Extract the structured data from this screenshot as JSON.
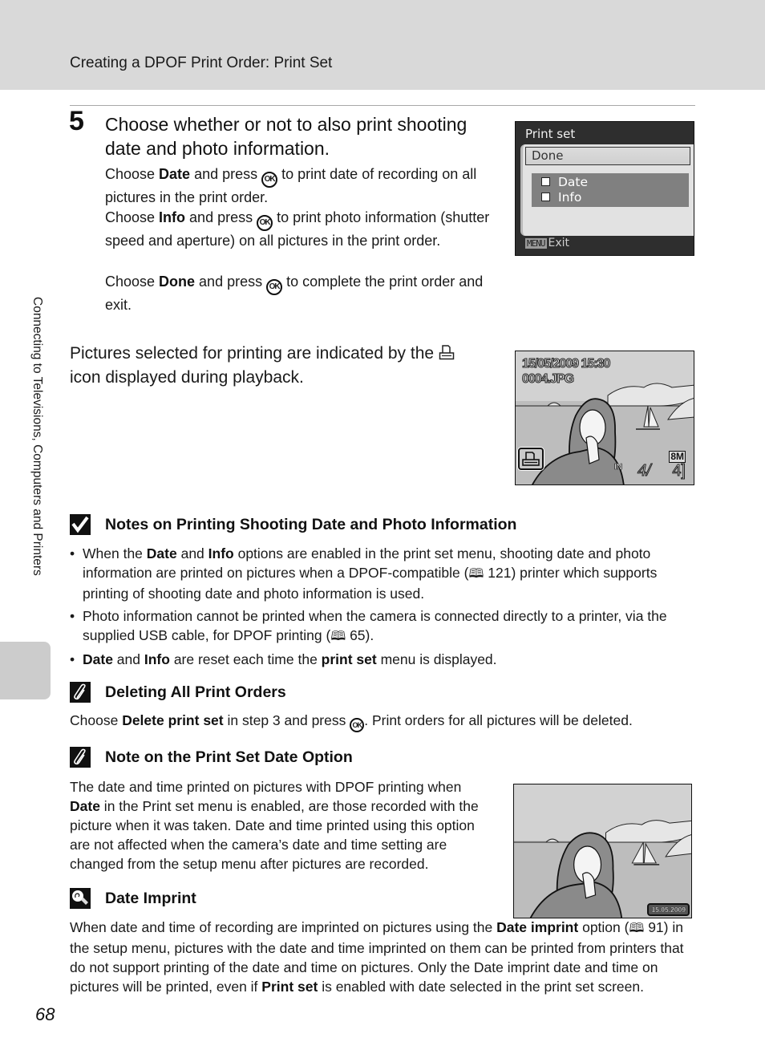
{
  "header": {
    "title": "Creating a DPOF Print Order: Print Set"
  },
  "side_tab": {
    "label": "Connecting to Televisions, Computers and Printers"
  },
  "step": {
    "number": "5",
    "title": "Choose whether or not to also print shooting date and photo information.",
    "paragraphs": [
      {
        "pre": "Choose ",
        "bold": "Date",
        "mid": " and press ",
        "button": "OK",
        "post": " to print date of recording on all pictures in the print order."
      },
      {
        "pre": "Choose ",
        "bold": "Info",
        "mid": " and press ",
        "button": "OK",
        "post": " to print photo information (shutter speed and aperture) on all pictures in the print order."
      },
      {
        "pre": "Choose ",
        "bold": "Done",
        "mid": " and press ",
        "button": "OK",
        "post": " to complete the print order and exit."
      }
    ]
  },
  "camera_menu": {
    "title": "Print set",
    "done_label": "Done",
    "options": [
      {
        "label": "Date",
        "checked": false
      },
      {
        "label": "Info",
        "checked": false
      }
    ],
    "menu_badge": "MENU",
    "exit_label": "Exit"
  },
  "indicated_text": {
    "pre": "Pictures selected for printing are indicated by the",
    "icon": "print-order-icon",
    "post": "icon displayed during playback."
  },
  "playback_screen": {
    "datetime": "15/05/2009 15:30",
    "filename": "0004.JPG",
    "image_size": "8M",
    "memory": "IN",
    "frame_current": "4/",
    "frame_total": "4]"
  },
  "notes": [
    {
      "icon": "check-icon",
      "title": "Notes on Printing Shooting Date and Photo Information",
      "bullets": [
        {
          "parts": [
            {
              "t": "When the "
            },
            {
              "b": "Date"
            },
            {
              "t": " and "
            },
            {
              "b": "Info"
            },
            {
              "t": " options are enabled in the print set menu, shooting date and photo information are printed on pictures when a DPOF-compatible ("
            },
            {
              "ref": "121"
            },
            {
              "t": ") printer which supports printing of shooting date and photo information is used."
            }
          ]
        },
        {
          "parts": [
            {
              "t": "Photo information cannot be printed when the camera is connected directly to a printer, via the supplied USB cable, for DPOF printing ("
            },
            {
              "ref": "65"
            },
            {
              "t": ")."
            }
          ]
        },
        {
          "parts": [
            {
              "b": "Date"
            },
            {
              "t": " and "
            },
            {
              "b": "Info"
            },
            {
              "t": " are reset each time the "
            },
            {
              "b": "print set"
            },
            {
              "t": " menu is displayed."
            }
          ]
        }
      ]
    },
    {
      "icon": "paperclip-icon",
      "title": "Deleting All Print Orders",
      "text": {
        "pre": "Choose ",
        "bold": "Delete print set",
        "mid": " in step 3 and press ",
        "button": "OK",
        "post": ". Print orders for all pictures will be deleted."
      }
    },
    {
      "icon": "paperclip-icon",
      "title": "Note on the Print Set Date Option",
      "text": {
        "pre": "The date and time printed on pictures with DPOF printing when ",
        "bold": "Date",
        "post": " in the Print set menu is enabled, are those recorded with the picture when it was taken. Date and time printed using this option are not affected when the camera’s date and time setting are changed from the setup menu after pictures are recorded."
      }
    },
    {
      "icon": "lightbulb-icon",
      "title": "Date Imprint",
      "text": {
        "pre": "When date and time of recording are imprinted on pictures using the ",
        "bold": "Date imprint",
        "mid": " option (",
        "ref": "91",
        "mid2": ") in the setup menu, pictures with the date and time imprinted on them can be printed from printers that do not support printing of the date and time on pictures. Only the Date imprint date and time on pictures will be printed, even if ",
        "bold2": "Print set",
        "post": " is enabled with date selected in the print set screen."
      }
    }
  ],
  "imprint_screen": {
    "date_stamp": "15.05.2009"
  },
  "page_number": "68",
  "book_icon": "🕮"
}
